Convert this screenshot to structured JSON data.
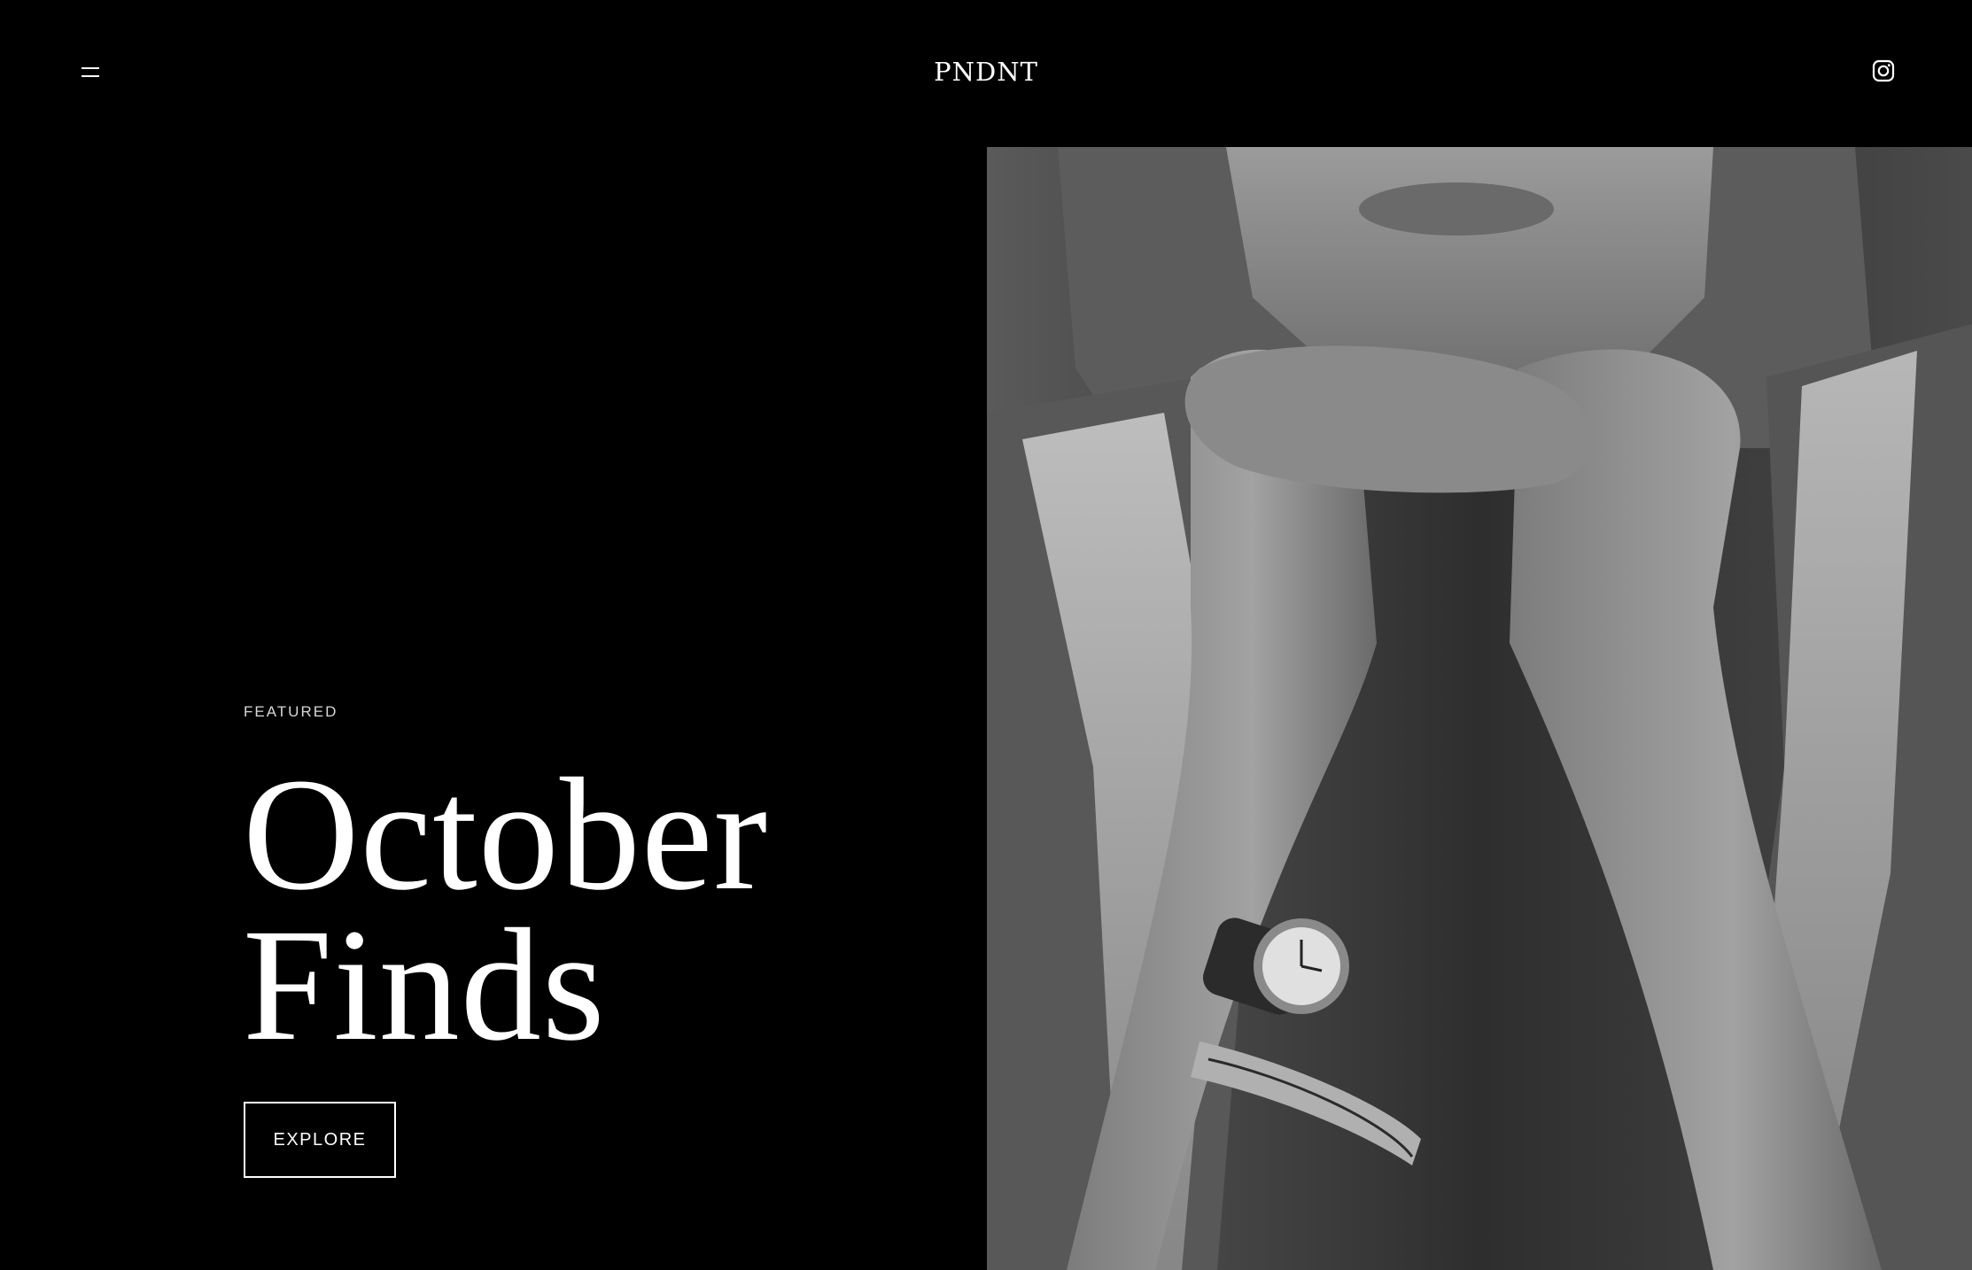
{
  "header": {
    "menu_icon": "hamburger-menu-icon",
    "brand": "PNDNT",
    "social_icon": "instagram-icon"
  },
  "hero": {
    "eyebrow": "FEATURED",
    "title_line1": "October",
    "title_line2": "Finds",
    "cta_label": "EXPLORE",
    "image": "black-and-white photo of a woman resting her chin on her hands, wearing a wristwatch and a metal bangle"
  },
  "colors": {
    "background": "#000000",
    "text": "#ffffff",
    "muted_text": "#d8d8d8"
  }
}
